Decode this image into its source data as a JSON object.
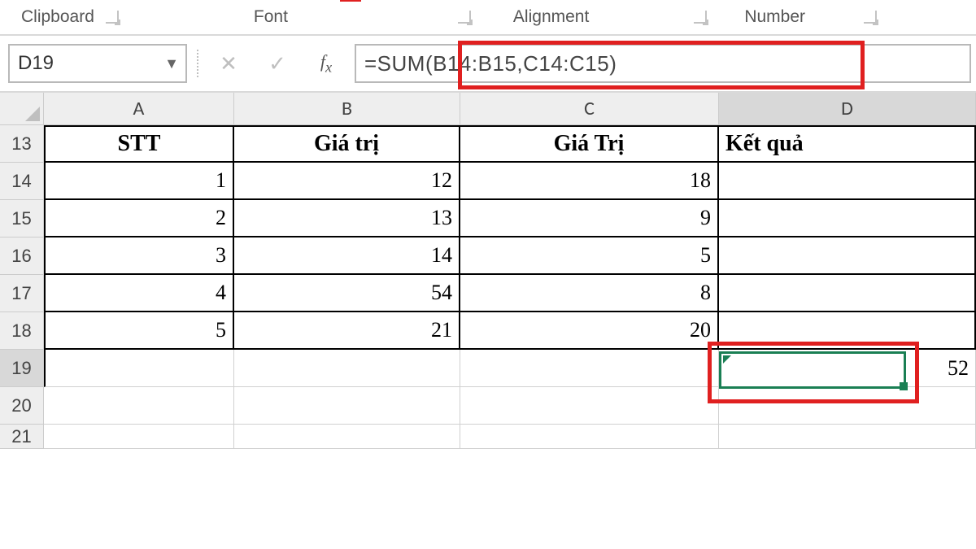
{
  "ribbon": {
    "groups": [
      "Clipboard",
      "Font",
      "Alignment",
      "Number"
    ]
  },
  "namebox": "D19",
  "formula": "=SUM(B14:B15,C14:C15)",
  "columns": [
    "A",
    "B",
    "C",
    "D"
  ],
  "rows": [
    "13",
    "14",
    "15",
    "16",
    "17",
    "18",
    "19",
    "20",
    "21"
  ],
  "headers": {
    "A": "STT",
    "B": "Giá trị",
    "C": "Giá Trị",
    "D": "Kết quả"
  },
  "data": {
    "14": {
      "A": "1",
      "B": "12",
      "C": "18",
      "D": ""
    },
    "15": {
      "A": "2",
      "B": "13",
      "C": "9",
      "D": ""
    },
    "16": {
      "A": "3",
      "B": "14",
      "C": "5",
      "D": ""
    },
    "17": {
      "A": "4",
      "B": "54",
      "C": "8",
      "D": ""
    },
    "18": {
      "A": "5",
      "B": "21",
      "C": "20",
      "D": ""
    },
    "19": {
      "A": "",
      "B": "",
      "C": "",
      "D": "52"
    }
  },
  "active": {
    "cell": "D19",
    "row": "19",
    "col": "D"
  }
}
